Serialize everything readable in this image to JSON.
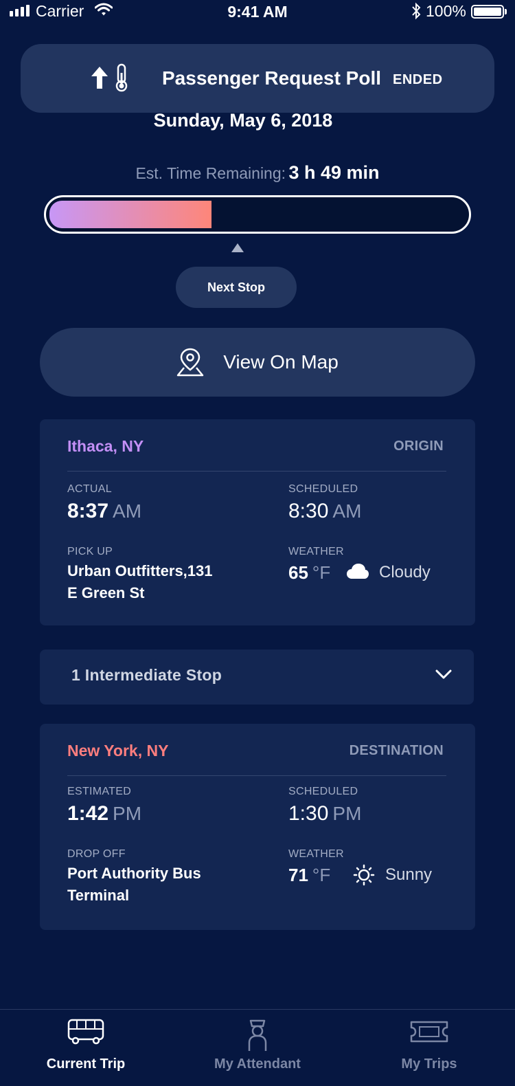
{
  "status_bar": {
    "carrier": "Carrier",
    "time": "9:41 AM",
    "battery": "100%"
  },
  "poll": {
    "title": "Passenger Request Poll",
    "status": "ENDED"
  },
  "trip": {
    "date": "Sunday, May 6, 2018",
    "time_remaining_label": "Est. Time Remaining:",
    "time_remaining_value": "3 h 49 min",
    "progress_fraction": 0.39,
    "next_stop_label": "Next Stop",
    "view_map_label": "View On Map"
  },
  "origin": {
    "city": "Ithaca, NY",
    "city_color": "#c38ff5",
    "role": "ORIGIN",
    "actual_label": "ACTUAL",
    "actual_time": "8:37",
    "actual_ampm": "AM",
    "scheduled_label": "SCHEDULED",
    "scheduled_time": "8:30",
    "scheduled_ampm": "AM",
    "location_label": "PICK UP",
    "location_line1": "Urban Outfitters,131",
    "location_line2": "E Green St",
    "weather_label": "WEATHER",
    "temperature": "65",
    "temp_unit": "°F",
    "weather_icon": "cloud-icon",
    "weather_text": "Cloudy"
  },
  "intermediate": {
    "label": "1 Intermediate Stop"
  },
  "destination": {
    "city": "New York, NY",
    "city_color": "#fd7e7e",
    "role": "DESTINATION",
    "actual_label": "ESTIMATED",
    "actual_time": "1:42",
    "actual_ampm": "PM",
    "scheduled_label": "SCHEDULED",
    "scheduled_time": "1:30",
    "scheduled_ampm": "PM",
    "location_label": "DROP OFF",
    "location_line1": "Port Authority Bus",
    "location_line2": "Terminal",
    "weather_label": "WEATHER",
    "temperature": "71",
    "temp_unit": "°F",
    "weather_icon": "sun-icon",
    "weather_text": "Sunny"
  },
  "tabs": [
    {
      "label": "Current Trip",
      "icon": "bus-icon",
      "active": true
    },
    {
      "label": "My Attendant",
      "icon": "attendant-icon",
      "active": false
    },
    {
      "label": "My Trips",
      "icon": "ticket-icon",
      "active": false
    }
  ]
}
